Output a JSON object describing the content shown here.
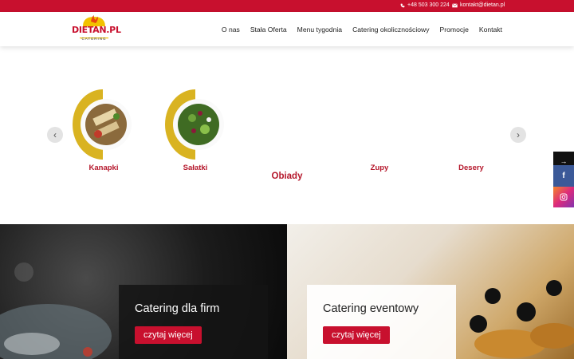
{
  "topbar": {
    "phone": "+48 503 300 224",
    "email": "kontakt@dietan.pl"
  },
  "logo": {
    "name": "DIETAN.PL",
    "sub": "CATERING"
  },
  "nav": {
    "items": [
      "O nas",
      "Stała Oferta",
      "Menu tygodnia",
      "Catering okolicznościowy",
      "Promocje",
      "Kontakt"
    ]
  },
  "carousel": {
    "categories": [
      "Kanapki",
      "Sałatki",
      "Obiady",
      "Zupy",
      "Desery"
    ],
    "prev_icon": "chevron-left-icon",
    "next_icon": "chevron-right-icon"
  },
  "heroes": [
    {
      "title": "Catering dla firm",
      "button": "czytaj więcej"
    },
    {
      "title": "Catering eventowy",
      "button": "czytaj więcej"
    }
  ],
  "social": {
    "share_icon": "arrow-right-icon",
    "fb_icon": "facebook-icon",
    "ig_icon": "instagram-icon"
  },
  "colors": {
    "brand_red": "#c8102e",
    "accent_yellow": "#f2c200"
  }
}
